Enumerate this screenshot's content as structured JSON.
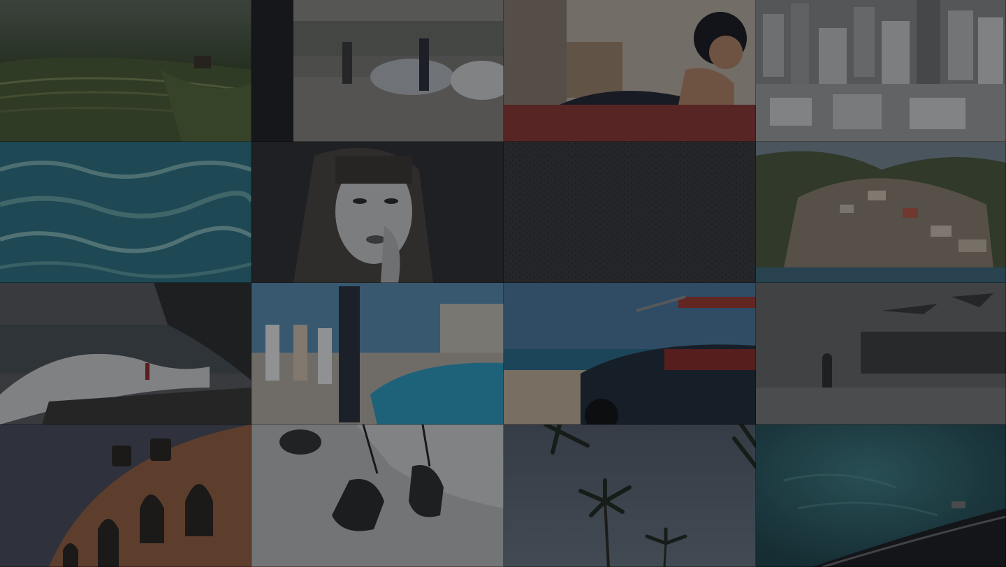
{
  "gallery": {
    "tiles": [
      {
        "id": "rice-terraces",
        "palette": [
          "#2c3b28",
          "#4b5c38",
          "#6f7a55"
        ]
      },
      {
        "id": "street-protest",
        "palette": [
          "#5a5853",
          "#7b7a74",
          "#9a9891"
        ]
      },
      {
        "id": "woman-on-bed",
        "palette": [
          "#6e2f2b",
          "#2e2a33",
          "#b9b2a9"
        ]
      },
      {
        "id": "city-aerial-bw",
        "palette": [
          "#3b3b3b",
          "#6b6b6b",
          "#9a9a9a"
        ]
      },
      {
        "id": "water-surface",
        "palette": [
          "#1e5e6c",
          "#2e7b8a",
          "#6fa7ab"
        ]
      },
      {
        "id": "bw-portrait",
        "palette": [
          "#262628",
          "#4a4a4c",
          "#c9c9c9"
        ]
      },
      {
        "id": "sand-texture",
        "palette": [
          "#2c2c2e",
          "#343436",
          "#3d3d40"
        ]
      },
      {
        "id": "positano-coast",
        "palette": [
          "#3c4a35",
          "#6b6557",
          "#8f7f70"
        ]
      },
      {
        "id": "wave-rocks",
        "palette": [
          "#2f3136",
          "#44474d",
          "#c8c8c8"
        ]
      },
      {
        "id": "skatepark-pool",
        "palette": [
          "#3f6f8e",
          "#2f95b8",
          "#c7c2b6"
        ]
      },
      {
        "id": "convertible-beach",
        "palette": [
          "#3e6c8f",
          "#1f2e3d",
          "#8d2c26"
        ]
      },
      {
        "id": "foggy-stage",
        "palette": [
          "#3a3a3a",
          "#575757",
          "#777777"
        ]
      },
      {
        "id": "colosseum-arches",
        "palette": [
          "#3b3f4a",
          "#7a4d33",
          "#a46a47"
        ]
      },
      {
        "id": "hanging-bells",
        "palette": [
          "#9c9c9c",
          "#c8c8c8",
          "#2a2a2a"
        ]
      },
      {
        "id": "palm-trees",
        "palette": [
          "#3a4450",
          "#4e5a66",
          "#1d2a22"
        ]
      },
      {
        "id": "sea-aerial",
        "palette": [
          "#1b3e45",
          "#23545c",
          "#3b7a80"
        ]
      }
    ]
  }
}
